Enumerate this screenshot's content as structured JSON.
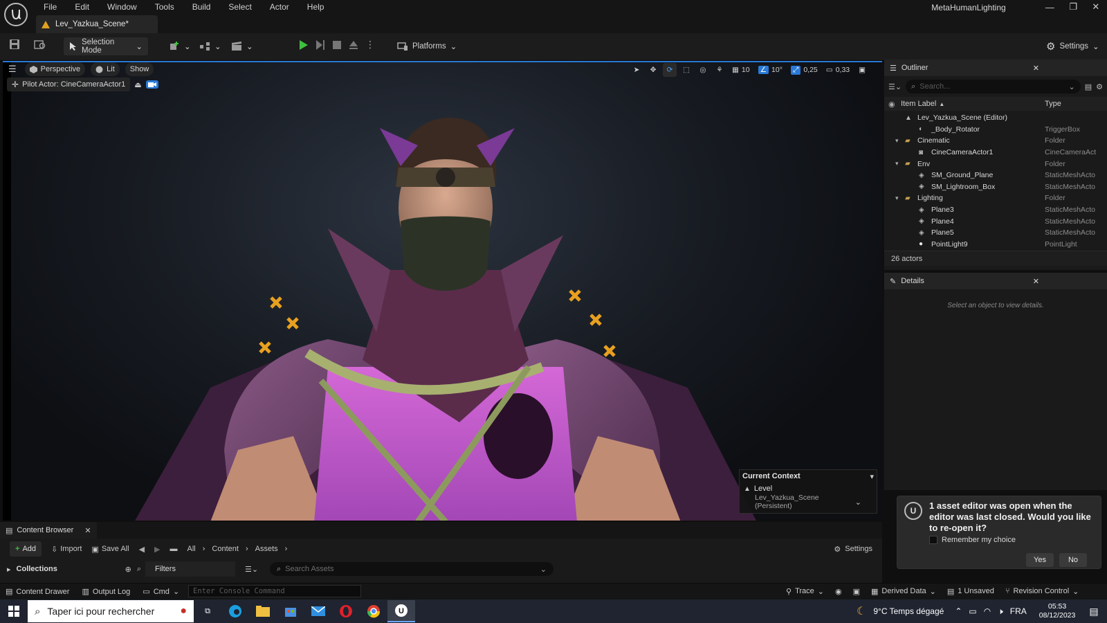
{
  "menu": [
    "File",
    "Edit",
    "Window",
    "Tools",
    "Build",
    "Select",
    "Actor",
    "Help"
  ],
  "project_name": "MetaHumanLighting",
  "document_tab": "Lev_Yazkua_Scene*",
  "toolbar": {
    "selection_mode": "Selection Mode",
    "platforms": "Platforms",
    "settings": "Settings"
  },
  "viewport": {
    "perspective": "Perspective",
    "lit": "Lit",
    "show": "Show",
    "pilot_actor": "Pilot Actor: CineCameraActor1",
    "grid_snap": "10",
    "angle_snap": "10°",
    "scale_snap": "0,25",
    "camera_speed": "0,33",
    "context": {
      "title": "Current Context",
      "level_label": "Level",
      "level_value": "Lev_Yazkua_Scene (Persistent)"
    }
  },
  "outliner": {
    "title": "Outliner",
    "search_placeholder": "Search...",
    "col_label": "Item Label",
    "col_type": "Type",
    "rows": [
      {
        "label": "Lev_Yazkua_Scene (Editor)",
        "type": "",
        "icon": "level-icon"
      },
      {
        "label": "_Body_Rotator",
        "type": "TriggerBox",
        "icon": "actor-icon"
      },
      {
        "label": "Cinematic",
        "type": "Folder",
        "icon": "folder-icon"
      },
      {
        "label": "CineCameraActor1",
        "type": "CineCameraAct",
        "icon": "camera-icon"
      },
      {
        "label": "Env",
        "type": "Folder",
        "icon": "folder-icon"
      },
      {
        "label": "SM_Ground_Plane",
        "type": "StaticMeshActo",
        "icon": "mesh-icon"
      },
      {
        "label": "SM_Lightroom_Box",
        "type": "StaticMeshActo",
        "icon": "mesh-icon"
      },
      {
        "label": "Lighting",
        "type": "Folder",
        "icon": "folder-icon"
      },
      {
        "label": "Plane3",
        "type": "StaticMeshActo",
        "icon": "mesh-icon"
      },
      {
        "label": "Plane4",
        "type": "StaticMeshActo",
        "icon": "mesh-icon"
      },
      {
        "label": "Plane5",
        "type": "StaticMeshActo",
        "icon": "mesh-icon"
      },
      {
        "label": "PointLight9",
        "type": "PointLight",
        "icon": "light-icon"
      }
    ],
    "actor_count": "26 actors"
  },
  "details": {
    "title": "Details",
    "empty_text": "Select an object to view details."
  },
  "notification": {
    "message": "1 asset editor was open when the editor was last closed. Would you like to re-open it?",
    "remember": "Remember my choice",
    "yes": "Yes",
    "no": "No"
  },
  "content_browser": {
    "tab": "Content Browser",
    "add": "Add",
    "import": "Import",
    "save_all": "Save All",
    "breadcrumb": [
      "All",
      "Content",
      "Assets"
    ],
    "settings": "Settings",
    "collections": "Collections",
    "filters": "Filters",
    "search_placeholder": "Search Assets"
  },
  "status_bar": {
    "content_drawer": "Content Drawer",
    "output_log": "Output Log",
    "cmd": "Cmd",
    "console_placeholder": "Enter Console Command",
    "trace": "Trace",
    "derived_data": "Derived Data",
    "unsaved": "1 Unsaved",
    "revision_control": "Revision Control"
  },
  "taskbar": {
    "search_placeholder": "Taper ici pour rechercher",
    "weather": "9°C  Temps dégagé",
    "language": "FRA",
    "time": "05:53",
    "date": "08/12/2023"
  },
  "colors": {
    "accent_blue": "#2a79d6",
    "play_green": "#3fbf3f",
    "warning_orange": "#e0a020"
  }
}
